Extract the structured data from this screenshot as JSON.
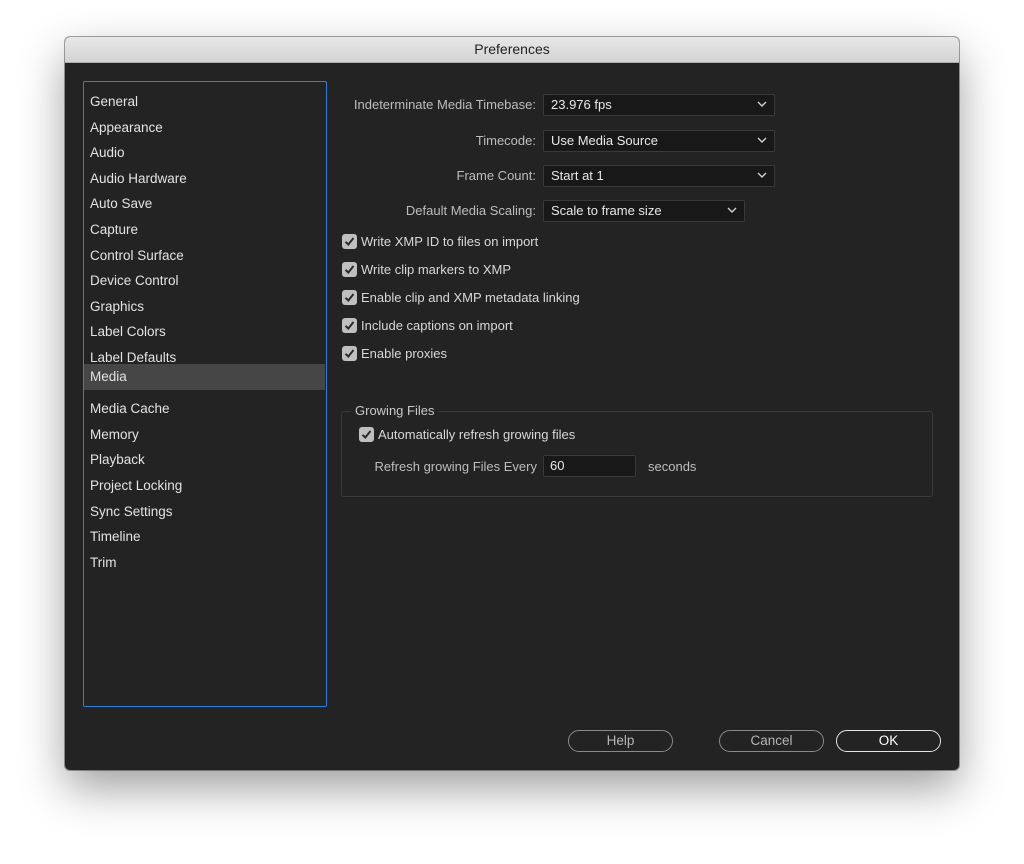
{
  "window": {
    "title": "Preferences"
  },
  "sidebar": {
    "items": [
      {
        "label": "General"
      },
      {
        "label": "Appearance"
      },
      {
        "label": "Audio"
      },
      {
        "label": "Audio Hardware"
      },
      {
        "label": "Auto Save"
      },
      {
        "label": "Capture"
      },
      {
        "label": "Control Surface"
      },
      {
        "label": "Device Control"
      },
      {
        "label": "Graphics"
      },
      {
        "label": "Label Colors"
      },
      {
        "label": "Label Defaults"
      },
      {
        "label": "Media",
        "selected": true
      },
      {
        "label": "Media Cache"
      },
      {
        "label": "Memory"
      },
      {
        "label": "Playback"
      },
      {
        "label": "Project Locking"
      },
      {
        "label": "Sync Settings"
      },
      {
        "label": "Timeline"
      },
      {
        "label": "Trim"
      }
    ]
  },
  "media": {
    "timebase": {
      "label": "Indeterminate Media Timebase:",
      "value": "23.976 fps"
    },
    "timecode": {
      "label": "Timecode:",
      "value": "Use Media Source"
    },
    "frame_count": {
      "label": "Frame Count:",
      "value": "Start at 1"
    },
    "scaling": {
      "label": "Default Media Scaling:",
      "value": "Scale to frame size"
    },
    "checkboxes": [
      {
        "label": "Write XMP ID to files on import",
        "checked": true
      },
      {
        "label": "Write clip markers to XMP",
        "checked": true
      },
      {
        "label": "Enable clip and XMP metadata linking",
        "checked": true
      },
      {
        "label": "Include captions on import",
        "checked": true
      },
      {
        "label": "Enable proxies",
        "checked": true
      }
    ]
  },
  "growing_files": {
    "title": "Growing Files",
    "auto_refresh": {
      "label": "Automatically refresh growing files",
      "checked": true
    },
    "refresh_label": "Refresh growing Files Every",
    "refresh_value": "60",
    "refresh_unit": "seconds"
  },
  "buttons": {
    "help": "Help",
    "cancel": "Cancel",
    "ok": "OK"
  },
  "colors": {
    "background": "#232323",
    "accent_border": "#2f7fd8",
    "selected_item": "#464646"
  },
  "icons": {
    "dropdown": "chevron-down-icon",
    "checkbox": "checkmark-icon"
  }
}
